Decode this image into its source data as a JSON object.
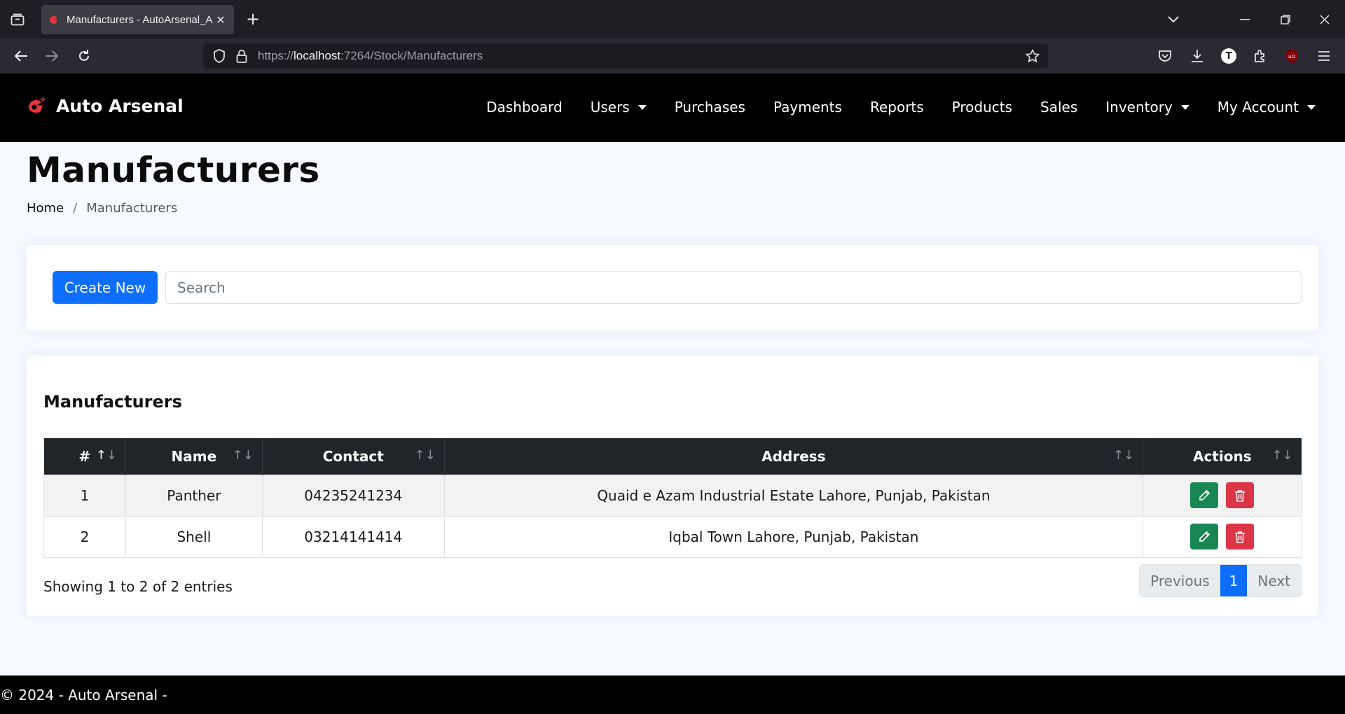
{
  "browser": {
    "tab_title": "Manufacturers - AutoArsenal_A",
    "url_prefix": "https://",
    "url_host": "localhost",
    "url_rest": ":7264/Stock/Manufacturers",
    "ext_letter": "T"
  },
  "header": {
    "brand": "Auto Arsenal",
    "menu": [
      {
        "label": "Dashboard"
      },
      {
        "label": "Users"
      },
      {
        "label": "Purchases"
      },
      {
        "label": "Payments"
      },
      {
        "label": "Reports"
      },
      {
        "label": "Products"
      },
      {
        "label": "Sales"
      },
      {
        "label": "Inventory"
      },
      {
        "label": "My Account"
      }
    ]
  },
  "page": {
    "title": "Manufacturers",
    "breadcrumb_home": "Home",
    "breadcrumb_sep": "/",
    "breadcrumb_current": "Manufacturers"
  },
  "toolbar": {
    "create_label": "Create New",
    "search_placeholder": "Search"
  },
  "table": {
    "title": "Manufacturers",
    "columns": [
      "#",
      "Name",
      "Contact",
      "Address",
      "Actions"
    ],
    "rows": [
      {
        "num": "1",
        "name": "Panther",
        "contact": "04235241234",
        "address": "Quaid e Azam Industrial Estate Lahore, Punjab, Pakistan"
      },
      {
        "num": "2",
        "name": "Shell",
        "contact": "03214141414",
        "address": "Iqbal Town Lahore, Punjab, Pakistan"
      }
    ],
    "info": "Showing 1 to 2 of 2 entries",
    "pager": {
      "prev": "Previous",
      "page": "1",
      "next": "Next"
    }
  },
  "footer": {
    "text": "© 2024 - Auto Arsenal -"
  },
  "colors": {
    "primary": "#0d6efd",
    "success": "#198754",
    "danger": "#dc3545",
    "header_bg": "#000000",
    "table_head": "#212529"
  }
}
